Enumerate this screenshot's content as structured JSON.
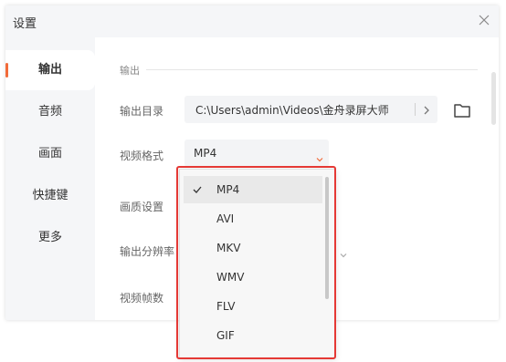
{
  "window": {
    "title": "设置"
  },
  "sidebar": {
    "items": [
      {
        "label": "输出",
        "active": true
      },
      {
        "label": "音频",
        "active": false
      },
      {
        "label": "画面",
        "active": false
      },
      {
        "label": "快捷键",
        "active": false
      },
      {
        "label": "更多",
        "active": false
      }
    ]
  },
  "content": {
    "section_title": "输出",
    "output_dir": {
      "label": "输出目录",
      "value": "C:\\Users\\admin\\Videos\\金舟录屏大师"
    },
    "video_format": {
      "label": "视频格式",
      "value": "MP4"
    },
    "quality": {
      "label": "画质设置"
    },
    "resolution": {
      "label": "输出分辨率"
    },
    "frame_rate": {
      "label": "视频帧数"
    }
  },
  "dropdown": {
    "options": [
      {
        "label": "MP4",
        "selected": true
      },
      {
        "label": "AVI",
        "selected": false
      },
      {
        "label": "MKV",
        "selected": false
      },
      {
        "label": "WMV",
        "selected": false
      },
      {
        "label": "FLV",
        "selected": false
      },
      {
        "label": "GIF",
        "selected": false
      }
    ]
  },
  "colors": {
    "accent": "#f26b3a",
    "highlight_border": "#e53935"
  },
  "icons": {
    "close": "close-icon",
    "folder": "folder-icon",
    "arrow": "chevron-right-icon",
    "caret": "chevron-down-icon",
    "check": "check-icon"
  }
}
